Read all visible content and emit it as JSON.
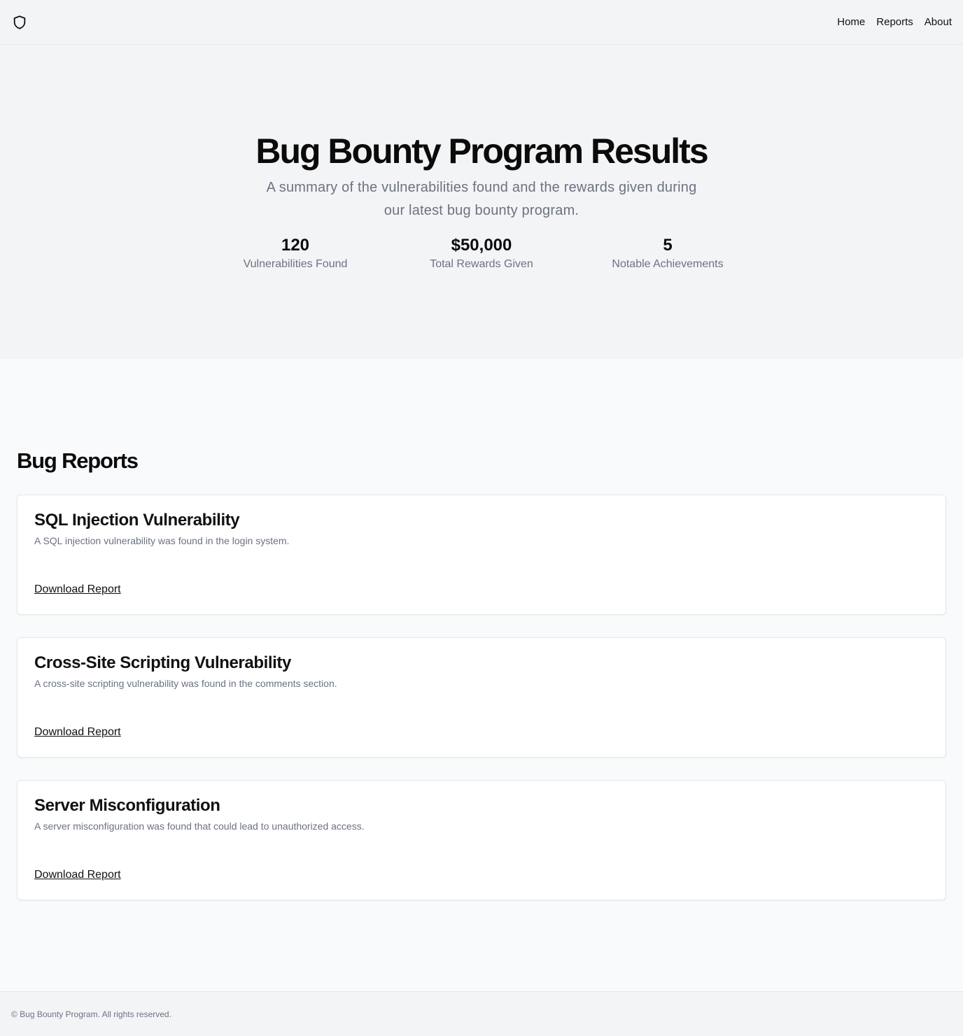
{
  "header": {
    "logo_icon": "shield-icon",
    "nav": [
      {
        "label": "Home"
      },
      {
        "label": "Reports"
      },
      {
        "label": "About"
      }
    ]
  },
  "hero": {
    "title": "Bug Bounty Program Results",
    "subtitle": "A summary of the vulnerabilities found and the rewards given during our latest bug bounty program.",
    "stats": [
      {
        "value": "120",
        "label": "Vulnerabilities Found"
      },
      {
        "value": "$50,000",
        "label": "Total Rewards Given"
      },
      {
        "value": "5",
        "label": "Notable Achievements"
      }
    ]
  },
  "reports": {
    "title": "Bug Reports",
    "items": [
      {
        "title": "SQL Injection Vulnerability",
        "description": "A SQL injection vulnerability was found in the login system.",
        "link_label": "Download Report"
      },
      {
        "title": "Cross-Site Scripting Vulnerability",
        "description": "A cross-site scripting vulnerability was found in the comments section.",
        "link_label": "Download Report"
      },
      {
        "title": "Server Misconfiguration",
        "description": "A server misconfiguration was found that could lead to unauthorized access.",
        "link_label": "Download Report"
      }
    ]
  },
  "footer": {
    "text": "© Bug Bounty Program. All rights reserved."
  },
  "colors": {
    "header_bg": "#f3f4f6",
    "page_bg": "#f9fafb",
    "muted_text": "#6b7280",
    "card_border": "#e5e7eb"
  }
}
